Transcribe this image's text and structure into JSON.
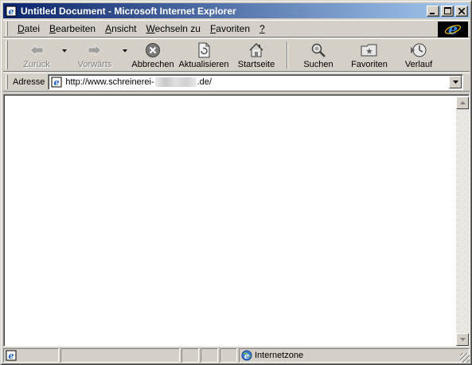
{
  "window": {
    "title": "Untitled Document - Microsoft Internet Explorer",
    "minimize": "_",
    "maximize": "□",
    "close": "×"
  },
  "menu": {
    "items": [
      {
        "label": "Datei",
        "underline": "D",
        "rest": "atei"
      },
      {
        "label": "Bearbeiten",
        "underline": "B",
        "rest": "earbeiten"
      },
      {
        "label": "Ansicht",
        "underline": "A",
        "rest": "nsicht"
      },
      {
        "label": "Wechseln zu",
        "underline": "W",
        "rest": "echseln zu"
      },
      {
        "label": "Favoriten",
        "underline": "F",
        "rest": "avoriten"
      },
      {
        "label": "?",
        "underline": "?",
        "rest": ""
      }
    ]
  },
  "toolbar": {
    "back": "Zurück",
    "forward": "Vorwärts",
    "stop": "Abbrechen",
    "refresh": "Aktualisieren",
    "home": "Startseite",
    "search": "Suchen",
    "favorites": "Favoriten",
    "history": "Verlauf"
  },
  "address": {
    "label": "Adresse",
    "url_prefix": "http://www.schreinerei-",
    "url_suffix": ".de/"
  },
  "status": {
    "zone": "Internetzone"
  },
  "colors": {
    "title_start": "#0a246a",
    "title_end": "#a6caf0",
    "chrome": "#d4d0c8",
    "ie_blue": "#1e5fc7"
  }
}
